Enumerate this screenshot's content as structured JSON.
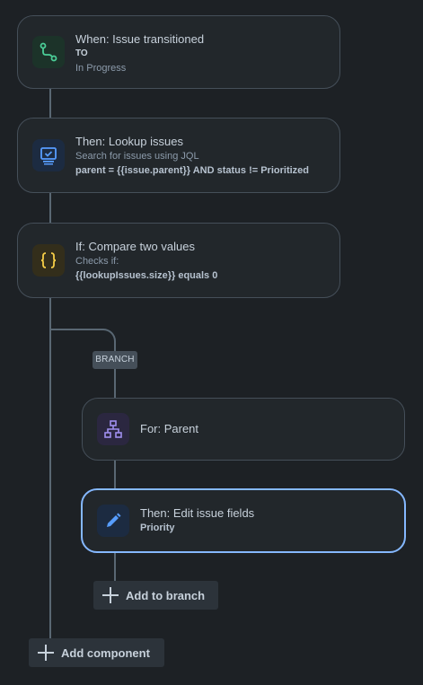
{
  "nodes": {
    "trigger": {
      "title": "When: Issue transitioned",
      "line1": "TO",
      "line2": "In Progress"
    },
    "lookup": {
      "title": "Then: Lookup issues",
      "line1": "Search for issues using JQL",
      "line2": "parent = {{issue.parent}} AND status != Prioritized"
    },
    "condition": {
      "title": "If: Compare two values",
      "line1": "Checks if:",
      "line2": "{{lookupIssues.size}} equals 0"
    },
    "branch_label": "BRANCH",
    "for_parent": {
      "title": "For: Parent"
    },
    "edit_fields": {
      "title": "Then: Edit issue fields",
      "line1": "Priority"
    }
  },
  "buttons": {
    "add_to_branch": "Add to branch",
    "add_component": "Add component"
  },
  "icons": {
    "trigger": "transition-icon",
    "lookup": "search-issues-icon",
    "condition": "condition-braces-icon",
    "for_parent": "hierarchy-icon",
    "edit_fields": "edit-pencil-icon"
  },
  "colors": {
    "background": "#1d2125",
    "card": "#22272b",
    "selected_border": "#85b8ff",
    "trigger_accent": "#4bce97",
    "lookup_accent": "#579dff",
    "condition_accent": "#f5cd47",
    "branch_accent": "#9f8fef"
  }
}
